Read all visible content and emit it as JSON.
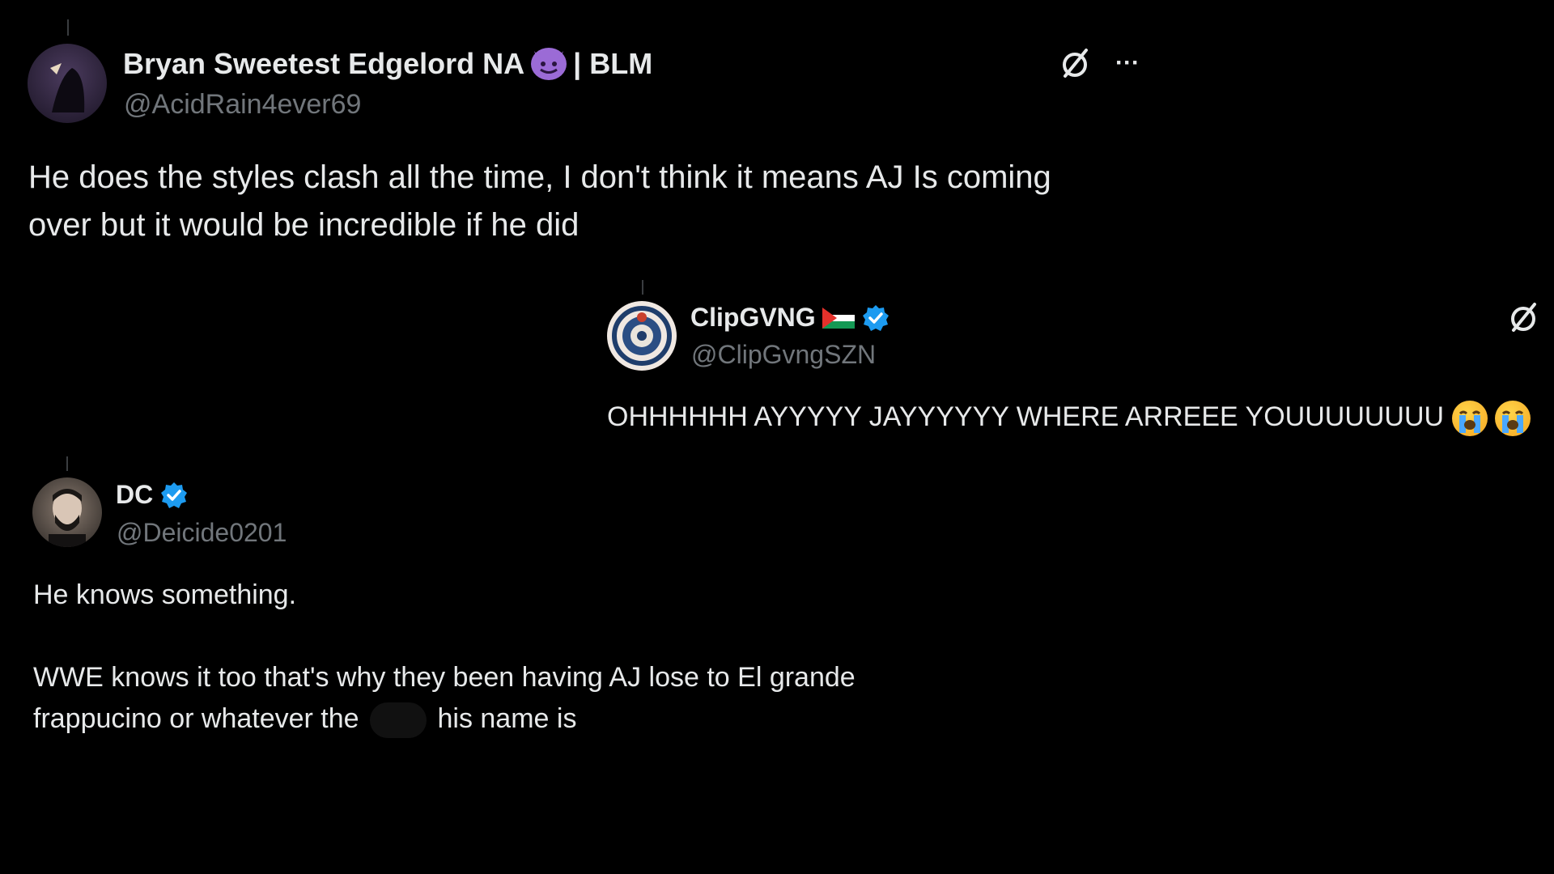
{
  "tweets": [
    {
      "display_name": "Bryan Sweetest Edgelord NA",
      "name_suffix": "| BLM",
      "handle": "@AcidRain4ever69",
      "text_line1": "He does the styles clash all the time, I don't think it means AJ Is coming",
      "text_line2": "over but it would be incredible if he did",
      "more_label": "···"
    },
    {
      "display_name": "ClipGVNG",
      "handle": "@ClipGvngSZN",
      "text": "OHHHHHH AYYYYY JAYYYYYY WHERE ARREEE YOUUUUUUUU"
    },
    {
      "display_name": "DC",
      "handle": "@Deicide0201",
      "text_line1": "He knows something.",
      "text_line2": "WWE knows it too that's why they been having AJ lose to El grande",
      "text_line3a": "frappucino or whatever the",
      "text_line3b": "his name is"
    }
  ],
  "colors": {
    "background": "#000000",
    "text": "#e7e9ea",
    "handle": "#71767b",
    "verified": "#1d9bf0"
  },
  "icons": [
    "grok-slash-icon",
    "more-icon",
    "verified-badge-icon",
    "devil-emoji-icon",
    "palestine-flag-icon",
    "crying-emoji-icon"
  ]
}
